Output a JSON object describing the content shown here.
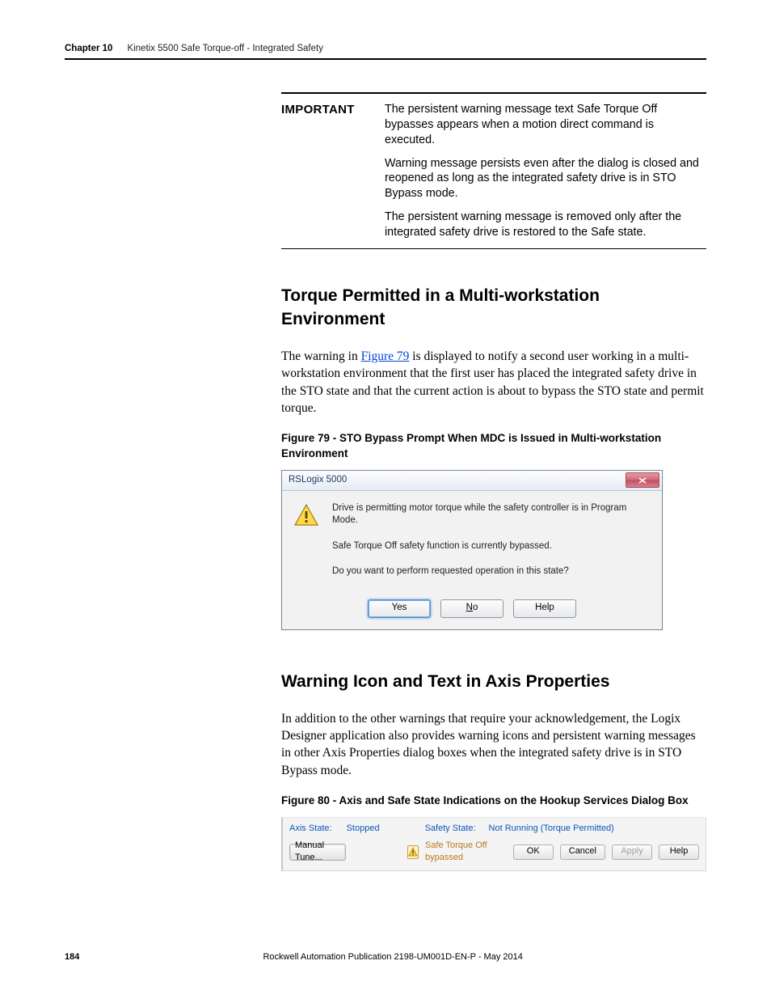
{
  "header": {
    "chapter": "Chapter 10",
    "title": "Kinetix 5500 Safe Torque-off - Integrated Safety"
  },
  "important": {
    "label": "IMPORTANT",
    "p1": "The persistent warning message text Safe Torque Off bypasses appears when a motion direct command is executed.",
    "p2": "Warning message persists even after the dialog is closed and reopened as long as the integrated safety drive is in STO Bypass mode.",
    "p3": "The persistent warning message is removed only after the integrated safety drive is restored to the Safe state."
  },
  "section1": {
    "heading": "Torque Permitted in a Multi-workstation Environment",
    "para_pre": "The warning in ",
    "link": "Figure 79",
    "para_post": " is displayed to notify a second user working in a multi-workstation environment that the first user has placed the integrated safety drive in the STO state and that the current action is about to bypass the STO state and permit torque.",
    "caption": "Figure 79 - STO Bypass Prompt When MDC is Issued in Multi-workstation Environment"
  },
  "dialog79": {
    "title": "RSLogix 5000",
    "line1": "Drive is permitting motor torque while the safety controller is in Program Mode.",
    "line2": "Safe Torque Off safety function is currently bypassed.",
    "line3": "Do you want to perform requested operation in this state?",
    "yes": "Yes",
    "no_pre": "N",
    "no_rest": "o",
    "help": "Help"
  },
  "section2": {
    "heading": "Warning Icon and Text in Axis Properties",
    "para": "In addition to the other warnings that require your acknowledgement, the Logix Designer application also provides warning icons and persistent warning messages in other Axis Properties dialog boxes when the integrated safety drive is in STO Bypass mode.",
    "caption": "Figure 80 - Axis and Safe State Indications on the Hookup Services Dialog Box"
  },
  "fig80": {
    "axis_state_label": "Axis State:",
    "axis_state_value": "Stopped",
    "safety_state_label": "Safety State:",
    "safety_state_value": "Not Running (Torque Permitted)",
    "manual_tune": "Manual Tune...",
    "warn_text": "Safe Torque Off bypassed",
    "ok": "OK",
    "cancel": "Cancel",
    "apply": "Apply",
    "help": "Help"
  },
  "footer": {
    "page": "184",
    "pub": "Rockwell Automation Publication 2198-UM001D-EN-P - May 2014"
  }
}
